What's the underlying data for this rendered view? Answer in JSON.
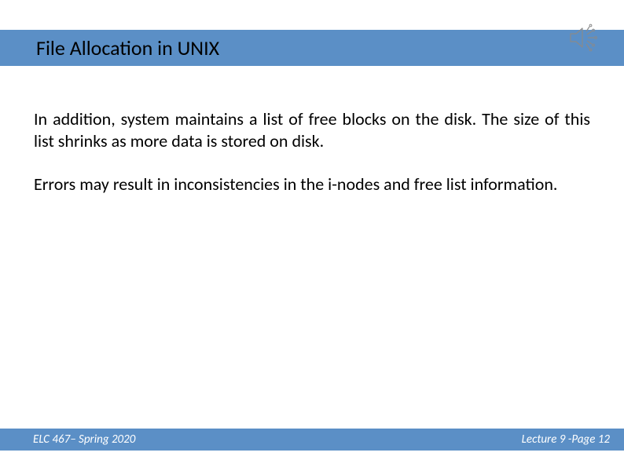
{
  "header": {
    "title": "File Allocation in UNIX"
  },
  "body": {
    "para1": "In addition, system maintains a list of free blocks on the disk.  The size of this list shrinks as more data is stored on disk.",
    "para2": "Errors may result in inconsistencies in the i-nodes and free list information."
  },
  "footer": {
    "left": "ELC 467– Spring 2020",
    "right": "Lecture 9 -Page 12"
  },
  "icons": {
    "speaker": "speaker-icon"
  },
  "colors": {
    "accent": "#5b8fc6",
    "text": "#000000",
    "footer_text": "#ffffff"
  }
}
